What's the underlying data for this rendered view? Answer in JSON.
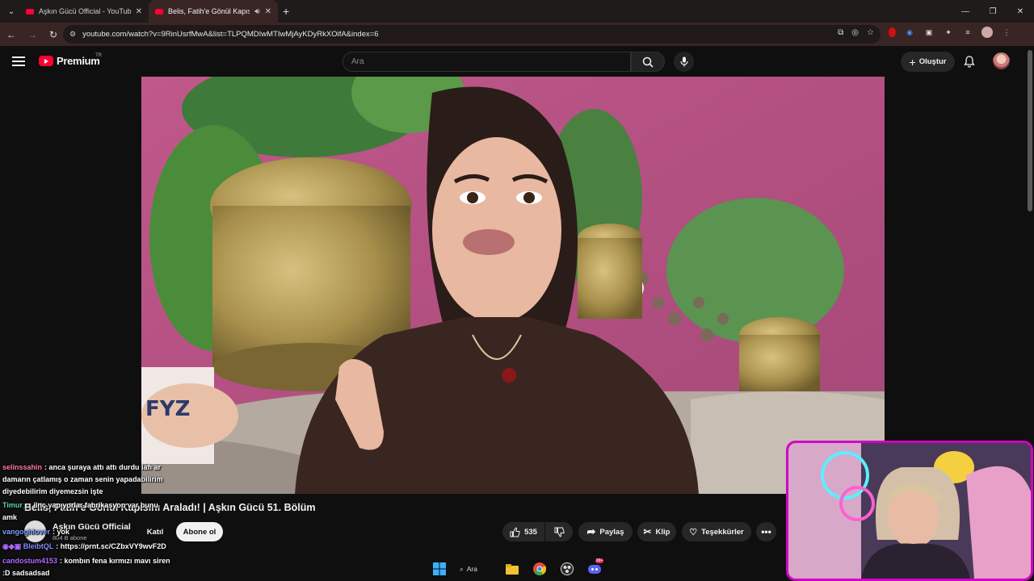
{
  "browser": {
    "tabs": [
      {
        "title": "Aşkın Gücü Official - YouTube",
        "active": false
      },
      {
        "title": "Belis, Fatih'e Gönül Kapısını",
        "active": true
      }
    ],
    "url": "youtube.com/watch?v=9RinUsrfMwA&list=TLPQMDIwMTIwMjAyKDyRkXOifA&index=6"
  },
  "youtube": {
    "logo_text": "Premium",
    "country_code": "TR",
    "search_placeholder": "Ara",
    "create_label": "Oluştur"
  },
  "video": {
    "title": "Belis, Fatih'e Gönül Kapısını Araladı! | Aşkın Gücü 51. Bölüm",
    "channel_name": "Aşkın Gücü Official",
    "subscribers": "804 B abone",
    "join_label": "Katıl",
    "subscribe_label": "Abone ol",
    "likes": "535",
    "share_label": "Paylaş",
    "clip_label": "Klip",
    "thanks_label": "Teşekkürler"
  },
  "chat": [
    {
      "user": "selinssahin",
      "color": "#ff7aa8",
      "text": ": anca şuraya attı attı durdu lafı ar"
    },
    {
      "user": "",
      "color": "#ffffff",
      "text": "damarın çatlamış o zaman senin yapadabilirim"
    },
    {
      "user": "",
      "color": "#ffffff",
      "text": "diyedebilirim diyemezsin işte"
    },
    {
      "user": "Timur_",
      "color": "#5fd4a0",
      "text": ": ilnç yapıyorlar fabrikasyon var bunu"
    },
    {
      "user": "",
      "color": "#ffffff",
      "text": "amk"
    },
    {
      "user": "vangoghlover",
      "color": "#7aa0ff",
      "text": ": yok"
    },
    {
      "user": "BleibtQL",
      "color": "#8a8aff",
      "text": ": https://prnt.sc/CZbxVY9wvF2D"
    },
    {
      "user": "candostum4153",
      "color": "#b06aff",
      "text": ": kombın fena kırmızı mavı siren"
    },
    {
      "user": "",
      "color": "#ffffff",
      "text": ":D sadsadsad"
    }
  ],
  "taskbar": {
    "search_label": "Ara",
    "notification_badge": "99+"
  },
  "colors": {
    "accent": "#ff0033",
    "webcam_border": "#d200c8",
    "browser_chrome": "#3a2525"
  }
}
